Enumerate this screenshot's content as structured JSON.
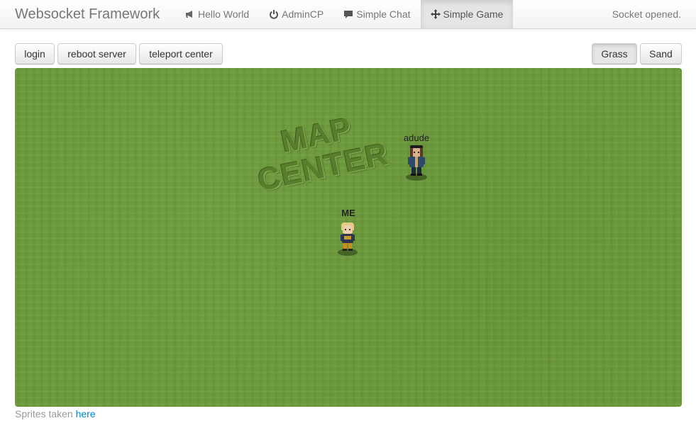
{
  "navbar": {
    "brand": "Websocket Framework",
    "items": [
      {
        "label": "Hello World",
        "icon": "bullhorn-icon",
        "active": false
      },
      {
        "label": "AdminCP",
        "icon": "power-icon",
        "active": false
      },
      {
        "label": "Simple Chat",
        "icon": "comment-icon",
        "active": false
      },
      {
        "label": "Simple Game",
        "icon": "move-icon",
        "active": true
      }
    ],
    "status": "Socket opened."
  },
  "toolbar": {
    "login_label": "login",
    "reboot_label": "reboot server",
    "teleport_label": "teleport center",
    "terrain": {
      "grass_label": "Grass",
      "sand_label": "Sand",
      "selected": "Grass"
    }
  },
  "game": {
    "terrain_color": "#6c9a3b",
    "map_center_line1": "MAP",
    "map_center_line2": "CENTER",
    "players": [
      {
        "name": "adude",
        "is_me": false
      },
      {
        "name": "ME",
        "is_me": true
      }
    ]
  },
  "footer": {
    "text": "Sprites taken",
    "link_label": "here"
  }
}
